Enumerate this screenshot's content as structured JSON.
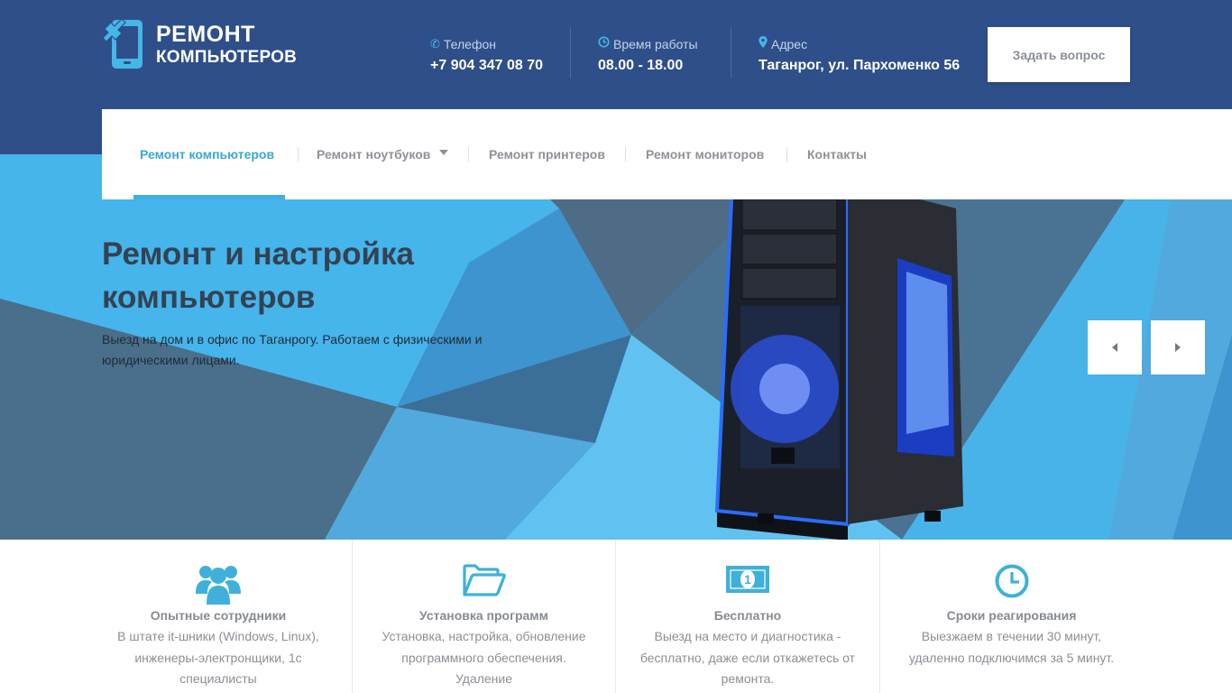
{
  "brand": {
    "line1": "РЕМОНТ",
    "line2": "КОМПЬЮТЕРОВ",
    "accent_color": "#44b7e6"
  },
  "header": {
    "phone": {
      "label": "Телефон",
      "value": "+7 904 347 08 70",
      "icon": "phone-icon"
    },
    "hours": {
      "label": "Время работы",
      "value": "08.00 - 18.00",
      "icon": "clock-icon"
    },
    "address": {
      "label": "Адрес",
      "value": "Таганрог, ул. Пархоменко 56",
      "icon": "map-marker-icon"
    },
    "ask_button": "Задать вопрос",
    "background_color": "#2e4f8a"
  },
  "nav": {
    "items": [
      {
        "label": "Ремонт компьютеров",
        "active": true
      },
      {
        "label": "Ремонт ноутбуков",
        "has_dropdown": true
      },
      {
        "label": "Ремонт принтеров"
      },
      {
        "label": "Ремонт мониторов"
      },
      {
        "label": "Контакты"
      }
    ]
  },
  "hero": {
    "title_line1": "Ремонт и настройка",
    "title_line2": "компьютеров",
    "subtitle": "Выезд на дом и в офис по Таганрогу. Работаем с физическими и юридическими лицами.",
    "prev_icon": "arrow-left-icon",
    "next_icon": "arrow-right-icon"
  },
  "features": [
    {
      "icon": "users-icon",
      "title": "Опытные сотрудники",
      "text": "В штате it-шники (Windows, Linux), инженеры-электронщики, 1с специалисты"
    },
    {
      "icon": "folder-open-icon",
      "title": "Установка программ",
      "text": "Установка, настройка, обновление программного обеспечения. Удаление"
    },
    {
      "icon": "money-icon",
      "title": "Бесплатно",
      "text": "Выезд на место и диагностика - бесплатно, даже если откажетесь от ремонта."
    },
    {
      "icon": "clock-icon",
      "title": "Сроки реагирования",
      "text": "Выезжаем в течении 30 минут, удаленно подключимся за 5 минут."
    }
  ]
}
